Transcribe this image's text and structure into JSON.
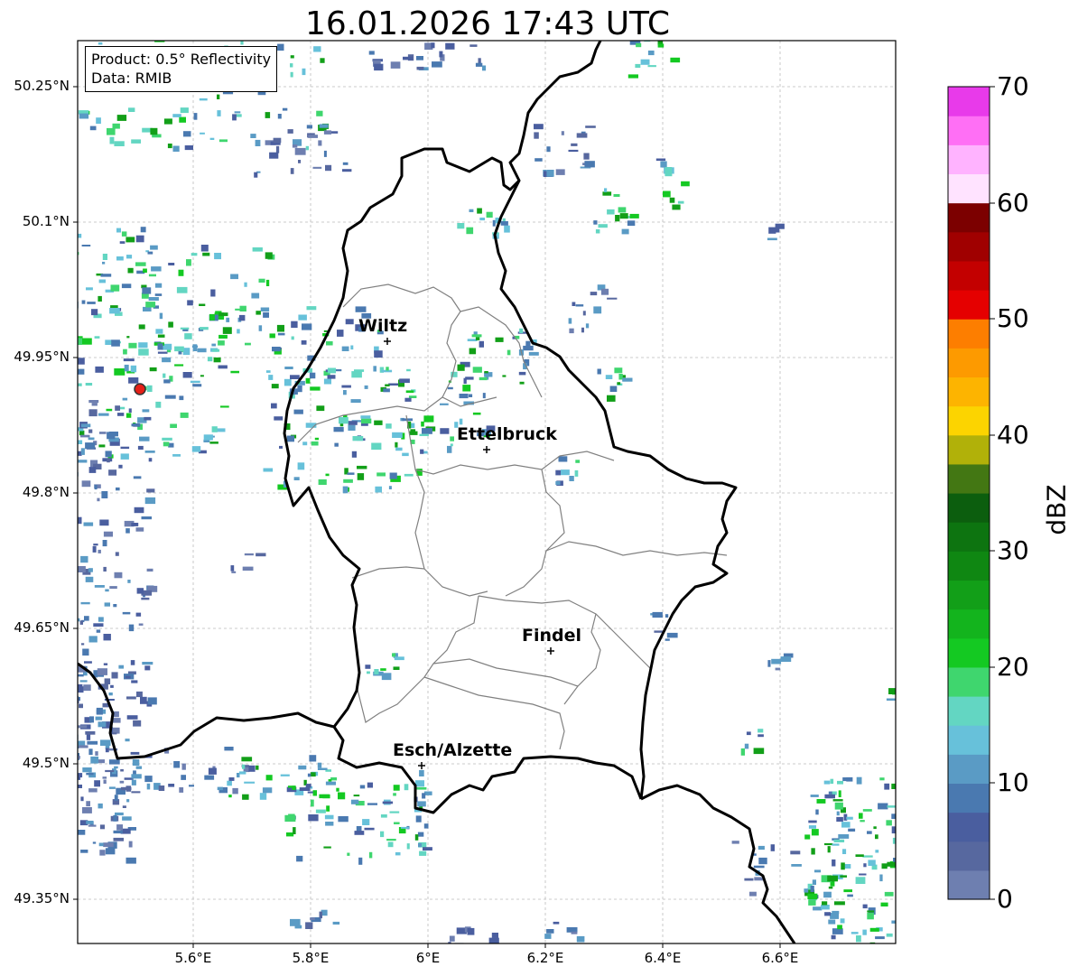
{
  "title": "16.01.2026 17:43 UTC",
  "info": {
    "product": "Product: 0.5° Reflectivity",
    "data": "Data: RMIB"
  },
  "lat_labels": [
    "50.25°N",
    "50.1°N",
    "49.95°N",
    "49.8°N",
    "49.65°N",
    "49.5°N",
    "49.35°N"
  ],
  "lon_labels": [
    "5.6°E",
    "5.8°E",
    "6°E",
    "6.2°E",
    "6.4°E",
    "6.6°E"
  ],
  "cities": [
    {
      "name": "Wiltz"
    },
    {
      "name": "Ettelbruck"
    },
    {
      "name": "Findel"
    },
    {
      "name": "Esch/Alzette"
    }
  ],
  "colorbar": {
    "label": "dBZ",
    "ticks": [
      "70",
      "60",
      "50",
      "40",
      "30",
      "20",
      "10",
      "0"
    ],
    "colors": [
      "#6e7fb0",
      "#57689f",
      "#4a5e9f",
      "#4a79b0",
      "#5a9bc5",
      "#67c1da",
      "#63d6c2",
      "#3fd66e",
      "#14c922",
      "#13b41d",
      "#129f18",
      "#0f8712",
      "#0d7410",
      "#0c5e0e",
      "#437713",
      "#b1b109",
      "#fcd400",
      "#fdb400",
      "#fd9a00",
      "#fd7e00",
      "#e50000",
      "#c30000",
      "#a00000",
      "#7c0000",
      "#ffe3ff",
      "#ffb3ff",
      "#ff6ff5",
      "#e83aea"
    ]
  }
}
